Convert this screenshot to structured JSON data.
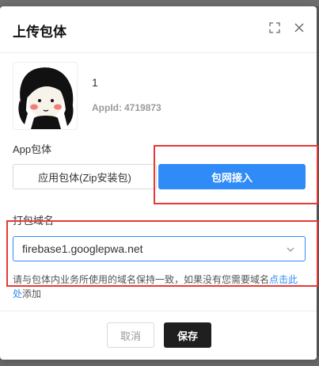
{
  "dialog": {
    "title": "上传包体"
  },
  "app": {
    "name": "1",
    "id_label": "AppId:",
    "id_value": "4719873"
  },
  "package": {
    "section_label": "App包体",
    "options": [
      {
        "label": "应用包体(Zip安装包)",
        "selected": false
      },
      {
        "label": "包网接入",
        "selected": true
      }
    ]
  },
  "domain": {
    "section_label": "打包域名",
    "selected_value": "firebase1.googlepwa.net",
    "help_text": "请与包体内业务所使用的域名保持一致，如果没有您需要域名",
    "help_link": "点击此处",
    "help_suffix": "添加"
  },
  "footer": {
    "cancel_label": "取消",
    "save_label": "保存"
  },
  "colors": {
    "accent": "#2f8bf7",
    "highlight": "#e53935",
    "save_button": "#1f1f1f"
  },
  "icons": {
    "fullscreen": "fullscreen-icon",
    "close": "close-icon",
    "chevron": "chevron-down-icon"
  }
}
